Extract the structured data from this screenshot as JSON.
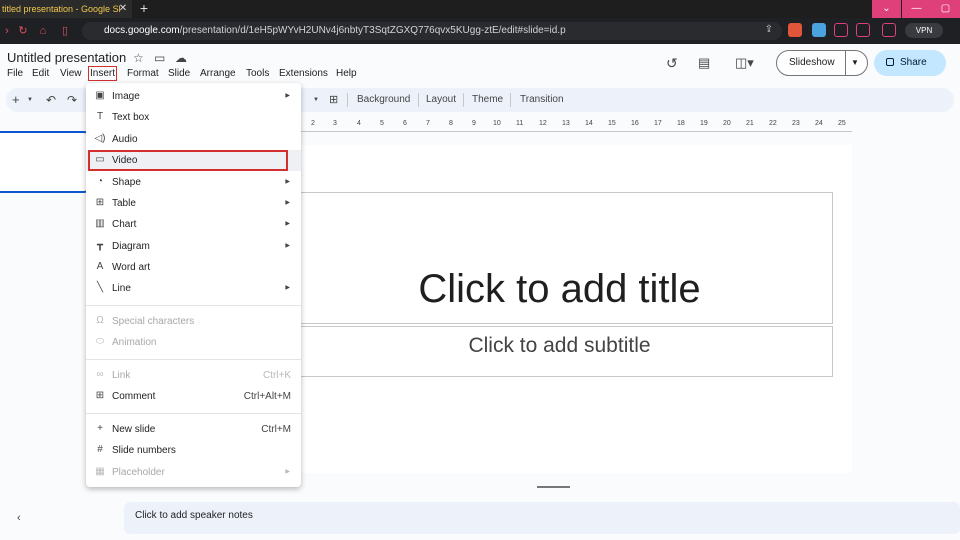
{
  "browser": {
    "tab_title": "titled presentation - Google Sl",
    "tab_close": "✕",
    "new_tab": "+",
    "url_host": "docs.google.com",
    "url_path": "/presentation/d/1eH5pWYvH2UNv4j6nbtyT3SqtZGXQ776qvx5KUgg-ztE/edit#slide=id.p",
    "vpn_label": "VPN",
    "window_controls": [
      "⌄",
      "—",
      "▢"
    ]
  },
  "header": {
    "title": "Untitled presentation",
    "menus": [
      "File",
      "Edit",
      "View",
      "Insert",
      "Format",
      "Slide",
      "Arrange",
      "Tools",
      "Extensions",
      "Help"
    ],
    "slideshow_label": "Slideshow",
    "share_label": "Share"
  },
  "toolbar": {
    "add": "+",
    "undo": "↶",
    "redo": "↷",
    "background": "Background",
    "layout": "Layout",
    "theme": "Theme",
    "transition": "Transition"
  },
  "ruler": [
    "2",
    "3",
    "4",
    "5",
    "6",
    "7",
    "8",
    "9",
    "10",
    "11",
    "12",
    "13",
    "14",
    "15",
    "16",
    "17",
    "18",
    "19",
    "20",
    "21",
    "22",
    "23",
    "24",
    "25"
  ],
  "slide": {
    "title_placeholder": "Click to add title",
    "subtitle_placeholder": "Click to add subtitle"
  },
  "notes": {
    "placeholder": "Click to add speaker notes",
    "collapse": "‹"
  },
  "insert_menu": {
    "image": "Image",
    "text_box": "Text box",
    "audio": "Audio",
    "video": "Video",
    "shape": "Shape",
    "table": "Table",
    "chart": "Chart",
    "diagram": "Diagram",
    "word_art": "Word art",
    "line": "Line",
    "special_characters": "Special characters",
    "animation": "Animation",
    "link": "Link",
    "link_shortcut": "Ctrl+K",
    "comment": "Comment",
    "comment_shortcut": "Ctrl+Alt+M",
    "new_slide": "New slide",
    "new_slide_shortcut": "Ctrl+M",
    "slide_numbers": "Slide numbers",
    "placeholder": "Placeholder"
  },
  "colors": {
    "highlight_red": "#d32f2f",
    "share_bg": "#c2e7ff",
    "selection_blue": "#0b57d0"
  }
}
